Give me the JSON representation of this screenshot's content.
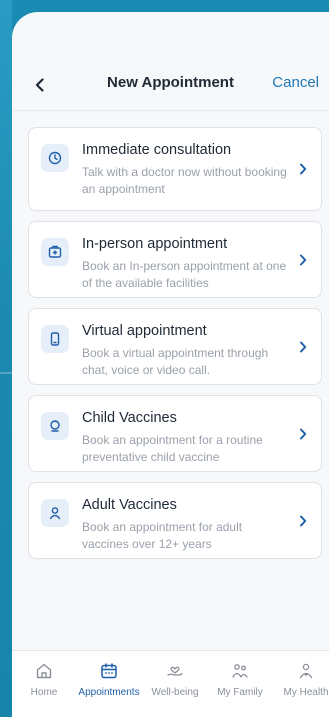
{
  "header": {
    "title": "New Appointment",
    "cancel_label": "Cancel"
  },
  "options": [
    {
      "title": "Immediate consultation",
      "desc": "Talk with a doctor now without booking an appointment",
      "icon": "doctor-icon"
    },
    {
      "title": "In-person appointment",
      "desc": "Book an In-person appointment at one of the available facilities",
      "icon": "clinic-icon"
    },
    {
      "title": "Virtual appointment",
      "desc": "Book a virtual appointment through chat, voice or video call.",
      "icon": "phone-icon"
    },
    {
      "title": "Child Vaccines",
      "desc": "Book an appointment for a routine preventative child vaccine",
      "icon": "child-icon"
    },
    {
      "title": "Adult Vaccines",
      "desc": "Book an appointment for adult vaccines over 12+ years",
      "icon": "person-icon"
    }
  ],
  "tabs": [
    {
      "label": "Home",
      "icon": "home-icon"
    },
    {
      "label": "Appointments",
      "icon": "calendar-icon",
      "active": true
    },
    {
      "label": "Well-being",
      "icon": "heart-hand-icon"
    },
    {
      "label": "My Family",
      "icon": "family-icon"
    },
    {
      "label": "My Health",
      "icon": "health-icon"
    }
  ],
  "colors": {
    "accent": "#1f78b4",
    "active_tab": "#1f5fa8",
    "background": "#1a8cb4"
  }
}
